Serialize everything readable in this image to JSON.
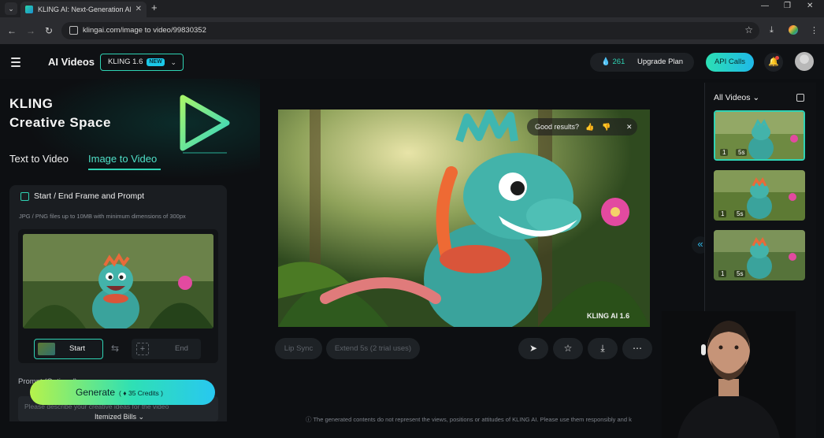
{
  "browser": {
    "tab_title": "KLING AI: Next-Generation AI C",
    "url": "klingai.com/image to video/99830352",
    "tab_close": "✕",
    "new_tab": "+"
  },
  "header": {
    "app_title": "AI Videos",
    "model": "KLING 1.6",
    "model_badge": "NEW",
    "credits": "261",
    "upgrade_label": "Upgrade Plan",
    "api_label": "API Calls"
  },
  "left": {
    "brand_line1": "KLING",
    "brand_line2": "Creative Space",
    "tabs": [
      {
        "label": "Text to Video"
      },
      {
        "label": "Image to Video"
      }
    ],
    "panel_title": "Start / End Frame and Prompt",
    "panel_hint": "JPG / PNG files up to 10MB with minimum dimensions of 300px",
    "start_label": "Start",
    "end_label": "End",
    "prompt_label": "Prompt (Optional)",
    "prompt_placeholder": "Please describe your creative ideas for the video",
    "generate_label": "Generate",
    "generate_credits": "35 Credits",
    "itemized_label": "Itemized Bills"
  },
  "center": {
    "feedback_label": "Good results?",
    "watermark": "KLING AI 1.6",
    "lip_sync_label": "Lip Sync",
    "extend_label": "Extend 5s (2 trial uses)",
    "disclaimer": "The generated contents do not represent the views, positions or attitudes of KLING AI. Please use them responsibly and k"
  },
  "right": {
    "all_videos_label": "All Videos",
    "thumbs": [
      {
        "count": "1",
        "duration": "5s"
      },
      {
        "count": "1",
        "duration": "5s"
      },
      {
        "count": "1",
        "duration": "5s"
      }
    ]
  },
  "colors": {
    "accent": "#2fd3b4",
    "accent_blue": "#1fb8e8",
    "background": "#0d0f12",
    "panel": "#1a1d21"
  }
}
